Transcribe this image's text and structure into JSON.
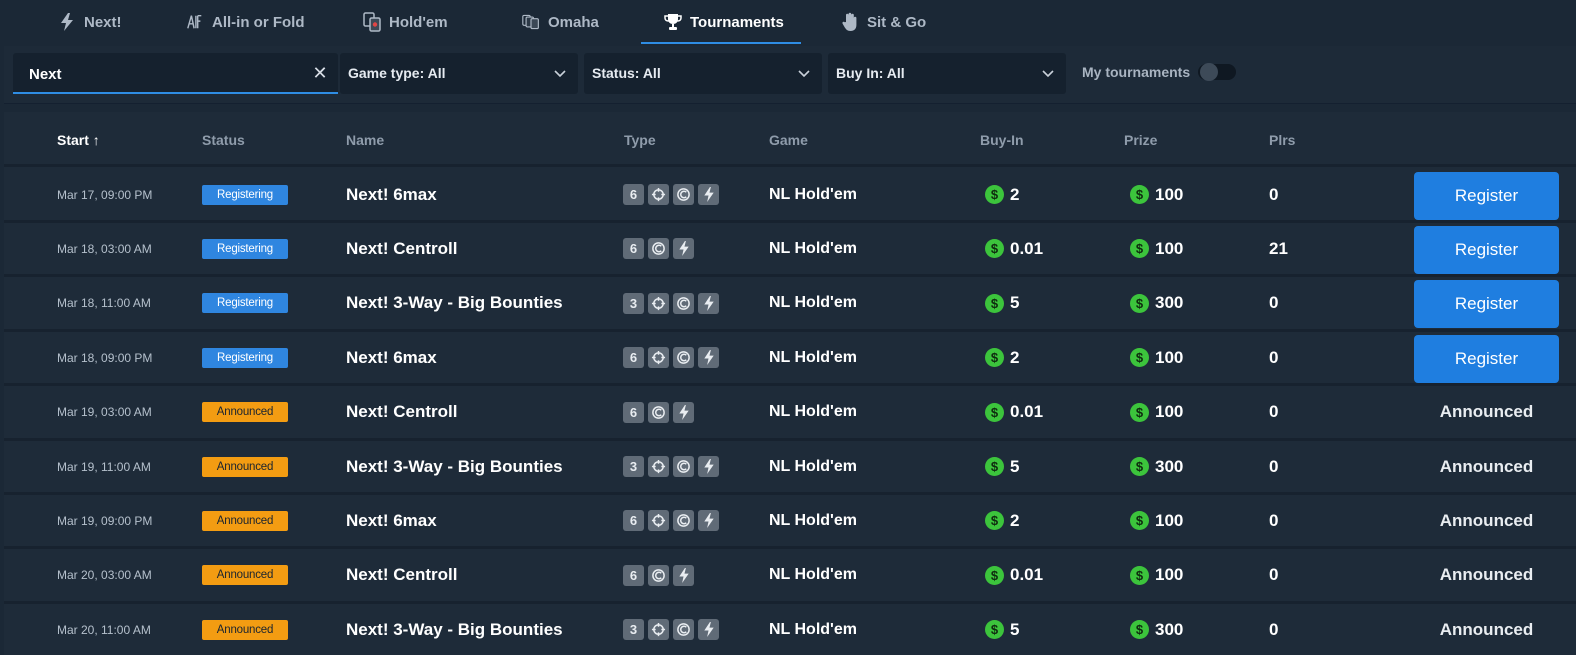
{
  "tabs": [
    {
      "label": "Next!",
      "icon": "lightning-icon"
    },
    {
      "label": "All-in or Fold",
      "icon": "all-in-icon"
    },
    {
      "label": "Hold'em",
      "icon": "cards-icon"
    },
    {
      "label": "Omaha",
      "icon": "omaha-cards-icon"
    },
    {
      "label": "Tournaments",
      "icon": "trophy-icon",
      "active": true
    },
    {
      "label": "Sit & Go",
      "icon": "hand-icon"
    }
  ],
  "filters": {
    "search_value": "Next",
    "game_type": "Game type: All",
    "status": "Status: All",
    "buy_in": "Buy In: All",
    "my_tournaments_label": "My tournaments",
    "my_tournaments_on": false
  },
  "table": {
    "headers": {
      "start": "Start ↑",
      "status": "Status",
      "name": "Name",
      "type": "Type",
      "game": "Game",
      "buyin": "Buy-In",
      "prize": "Prize",
      "plrs": "Plrs"
    },
    "rows": [
      {
        "start": "Mar 17, 09:00 PM",
        "status": "Registering",
        "name": "Next! 6max",
        "type": [
          "6",
          "target",
          "bounty",
          "bolt"
        ],
        "game": "NL Hold'em",
        "buyin": "2",
        "prize": "100",
        "plrs": "0",
        "action": "Register"
      },
      {
        "start": "Mar 18, 03:00 AM",
        "status": "Registering",
        "name": "Next! Centroll",
        "type": [
          "6",
          "bounty",
          "bolt"
        ],
        "game": "NL Hold'em",
        "buyin": "0.01",
        "prize": "100",
        "plrs": "21",
        "action": "Register"
      },
      {
        "start": "Mar 18, 11:00 AM",
        "status": "Registering",
        "name": "Next! 3-Way - Big Bounties",
        "type": [
          "3",
          "target",
          "bounty",
          "bolt"
        ],
        "game": "NL Hold'em",
        "buyin": "5",
        "prize": "300",
        "plrs": "0",
        "action": "Register"
      },
      {
        "start": "Mar 18, 09:00 PM",
        "status": "Registering",
        "name": "Next! 6max",
        "type": [
          "6",
          "target",
          "bounty",
          "bolt"
        ],
        "game": "NL Hold'em",
        "buyin": "2",
        "prize": "100",
        "plrs": "0",
        "action": "Register"
      },
      {
        "start": "Mar 19, 03:00 AM",
        "status": "Announced",
        "name": "Next! Centroll",
        "type": [
          "6",
          "bounty",
          "bolt"
        ],
        "game": "NL Hold'em",
        "buyin": "0.01",
        "prize": "100",
        "plrs": "0",
        "action": "Announced"
      },
      {
        "start": "Mar 19, 11:00 AM",
        "status": "Announced",
        "name": "Next! 3-Way - Big Bounties",
        "type": [
          "3",
          "target",
          "bounty",
          "bolt"
        ],
        "game": "NL Hold'em",
        "buyin": "5",
        "prize": "300",
        "plrs": "0",
        "action": "Announced"
      },
      {
        "start": "Mar 19, 09:00 PM",
        "status": "Announced",
        "name": "Next! 6max",
        "type": [
          "6",
          "target",
          "bounty",
          "bolt"
        ],
        "game": "NL Hold'em",
        "buyin": "2",
        "prize": "100",
        "plrs": "0",
        "action": "Announced"
      },
      {
        "start": "Mar 20, 03:00 AM",
        "status": "Announced",
        "name": "Next! Centroll",
        "type": [
          "6",
          "bounty",
          "bolt"
        ],
        "game": "NL Hold'em",
        "buyin": "0.01",
        "prize": "100",
        "plrs": "0",
        "action": "Announced"
      },
      {
        "start": "Mar 20, 11:00 AM",
        "status": "Announced",
        "name": "Next! 3-Way - Big Bounties",
        "type": [
          "3",
          "target",
          "bounty",
          "bolt"
        ],
        "game": "NL Hold'em",
        "buyin": "5",
        "prize": "300",
        "plrs": "0",
        "action": "Announced"
      }
    ]
  },
  "colors": {
    "background": "#1b2836",
    "accent": "#2f86e0",
    "registering": "#2f86e0",
    "announced": "#f39c12",
    "coin": "#3cc43c"
  }
}
